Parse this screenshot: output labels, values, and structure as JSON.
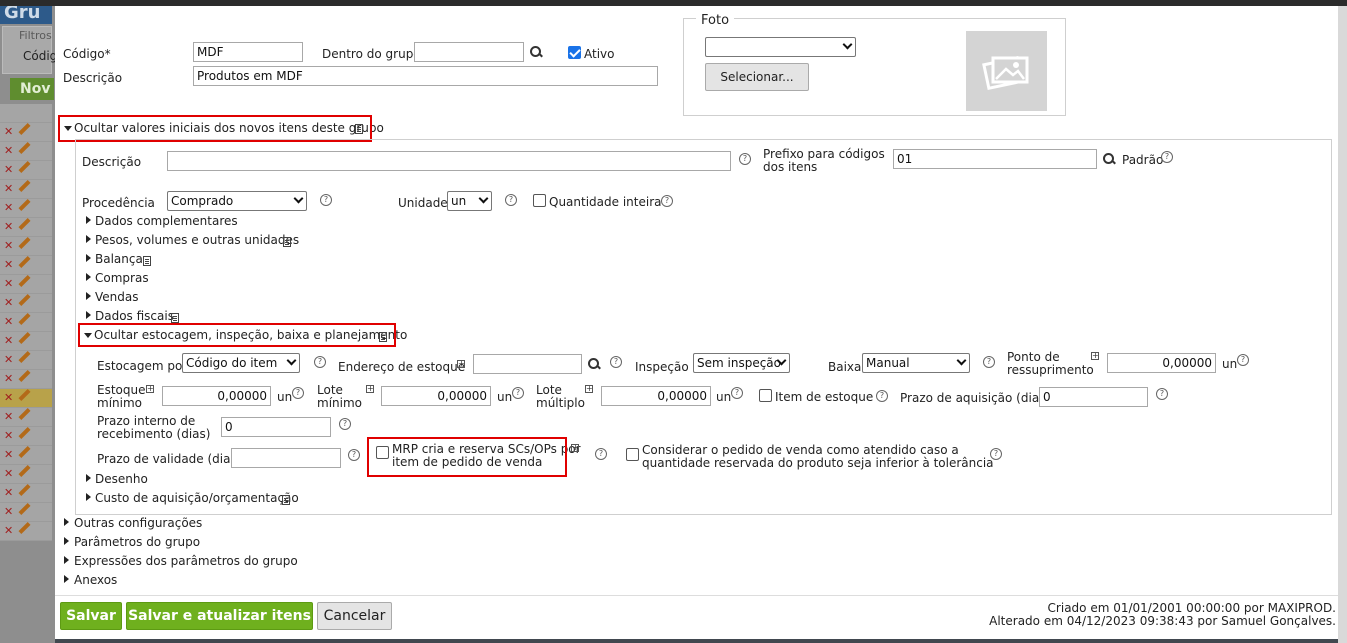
{
  "background": {
    "title": "Gru",
    "filters_label": "Filtros",
    "code_label": "Códig",
    "new_button": "Nov"
  },
  "form": {
    "codigo_label": "Código*",
    "codigo_value": "MDF",
    "dentro_grupo_label": "Dentro do grupo",
    "dentro_grupo_value": "",
    "ativo_label": "Ativo",
    "ativo_checked": true,
    "descricao_label": "Descrição",
    "descricao_value": "Produtos em MDF"
  },
  "foto": {
    "legend": "Foto",
    "select_value": "",
    "select_button": "Selecionar..."
  },
  "initial_section": {
    "toggle_label": "Ocultar valores iniciais dos novos itens deste grupo",
    "descricao_label": "Descrição",
    "descricao_value": "",
    "prefixo_label_1": "Prefixo para códigos",
    "prefixo_label_2": "dos itens",
    "prefixo_value": "01",
    "padrao_label": "Padrão",
    "procedencia_label": "Procedência",
    "procedencia_value": "Comprado",
    "unidade_label": "Unidade",
    "unidade_value": "un",
    "qtd_inteira_label": "Quantidade inteira",
    "subsections": [
      "Dados complementares",
      "Pesos, volumes e outras unidades",
      "Balança",
      "Compras",
      "Vendas",
      "Dados fiscais"
    ]
  },
  "estocagem": {
    "toggle_label": "Ocultar estocagem, inspeção, baixa e planejamento",
    "estocagem_por_label": "Estocagem por",
    "estocagem_por_value": "Código do item",
    "endereco_label": "Endereço de estoque",
    "endereco_value": "",
    "inspecao_label": "Inspeção",
    "inspecao_value": "Sem inspeção",
    "baixa_label": "Baixa",
    "baixa_value": "Manual",
    "ponto_label_1": "Ponto de",
    "ponto_label_2": "ressuprimento",
    "ponto_value": "0,00000",
    "unit": "un",
    "estoque_min_label_1": "Estoque",
    "estoque_min_label_2": "mínimo",
    "estoque_min_value": "0,00000",
    "lote_min_label_1": "Lote",
    "lote_min_label_2": "mínimo",
    "lote_min_value": "0,00000",
    "lote_mult_label_1": "Lote",
    "lote_mult_label_2": "múltiplo",
    "lote_mult_value": "0,00000",
    "item_estoque_label": "Item de estoque",
    "prazo_aq_label": "Prazo de aquisição (dias)",
    "prazo_aq_value": "0",
    "prazo_interno_label_1": "Prazo interno de",
    "prazo_interno_label_2": "recebimento (dias)",
    "prazo_interno_value": "0",
    "prazo_validade_label": "Prazo de validade (dias)",
    "prazo_validade_value": "",
    "mrp_label_1": "MRP cria e reserva SCs/OPs por",
    "mrp_label_2": "item de pedido de venda",
    "considerar_label_1": "Considerar o pedido de venda como atendido caso a",
    "considerar_label_2": "quantidade reservada do produto seja inferior à tolerância",
    "subsections": [
      "Desenho",
      "Custo de aquisição/orçamentação"
    ]
  },
  "outer_sections": [
    "Outras configurações",
    "Parâmetros do grupo",
    "Expressões dos parâmetros do grupo",
    "Anexos"
  ],
  "footer": {
    "save": "Salvar",
    "save_update": "Salvar e atualizar itens",
    "cancel": "Cancelar",
    "created": "Criado em 01/01/2001 00:00:00 por MAXIPROD.",
    "altered": "Alterado em 04/12/2023 09:38:43 por Samuel Gonçalves."
  },
  "colors": {
    "accent_green": "#6fb01e",
    "highlight_red": "#e00000",
    "checkbox_blue": "#1a73e8"
  }
}
